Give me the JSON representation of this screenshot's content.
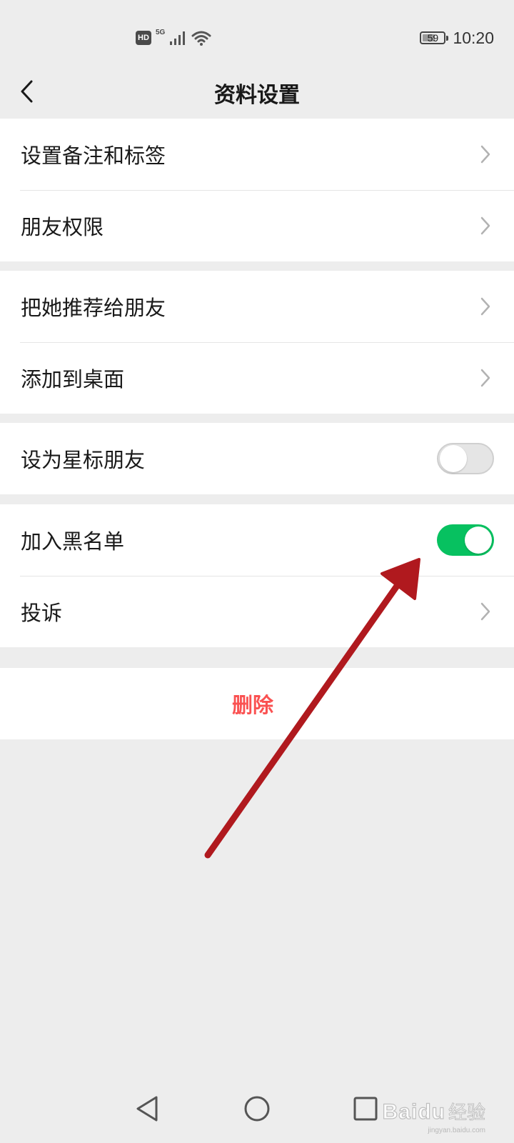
{
  "status_bar": {
    "hd": "HD",
    "network": "5G",
    "battery": "59",
    "battery_level": 0.59,
    "time": "10:20"
  },
  "header": {
    "title": "资料设置",
    "back_icon": "chevron-left-icon"
  },
  "groups": [
    {
      "items": [
        {
          "label": "设置备注和标签",
          "control": "chevron"
        },
        {
          "label": "朋友权限",
          "control": "chevron"
        }
      ]
    },
    {
      "items": [
        {
          "label": "把她推荐给朋友",
          "control": "chevron"
        },
        {
          "label": "添加到桌面",
          "control": "chevron"
        }
      ]
    },
    {
      "items": [
        {
          "label": "设为星标朋友",
          "control": "toggle",
          "on": false
        }
      ]
    },
    {
      "items": [
        {
          "label": "加入黑名单",
          "control": "toggle",
          "on": true
        },
        {
          "label": "投诉",
          "control": "chevron"
        }
      ]
    }
  ],
  "delete": {
    "label": "删除"
  },
  "colors": {
    "background": "#ededed",
    "surface": "#ffffff",
    "toggle_on": "#07c160",
    "danger": "#fa5151",
    "annotation_arrow": "#b0191e"
  },
  "nav_bar": {
    "back_icon": "triangle-back-icon",
    "home_icon": "circle-home-icon",
    "recents_icon": "square-recents-icon"
  },
  "watermark": {
    "logo": "Baidu",
    "brand": "经验",
    "domain": "jingyan.baidu.com"
  }
}
